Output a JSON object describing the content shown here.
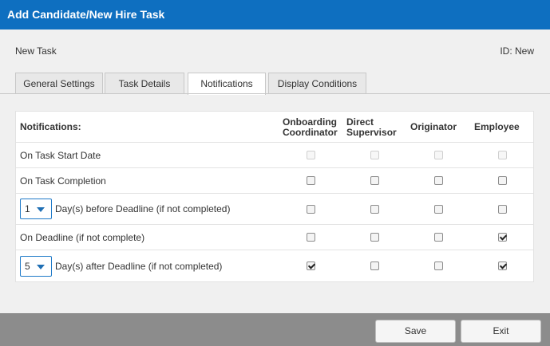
{
  "window": {
    "title": "Add Candidate/New Hire Task"
  },
  "task": {
    "name": "New Task",
    "id_label": "ID: New"
  },
  "tabs": [
    {
      "label": "General Settings",
      "active": false
    },
    {
      "label": "Task Details",
      "active": false
    },
    {
      "label": "Notifications",
      "active": true
    },
    {
      "label": "Display Conditions",
      "active": false
    }
  ],
  "table": {
    "header_label": "Notifications:",
    "columns": [
      {
        "line1": "Onboarding",
        "line2": "Coordinator"
      },
      {
        "line1": "Direct",
        "line2": "Supervisor"
      },
      {
        "line1": "Originator",
        "line2": ""
      },
      {
        "line1": "Employee",
        "line2": ""
      }
    ],
    "rows": [
      {
        "label": "On Task Start Date",
        "select_value": null,
        "checks": [
          false,
          false,
          false,
          false
        ],
        "disabled": true
      },
      {
        "label": "On Task Completion",
        "select_value": null,
        "checks": [
          false,
          false,
          false,
          false
        ],
        "disabled": false
      },
      {
        "label": "Day(s) before Deadline (if not completed)",
        "select_value": "1",
        "checks": [
          false,
          false,
          false,
          false
        ],
        "disabled": false
      },
      {
        "label": "On Deadline (if not complete)",
        "select_value": null,
        "checks": [
          false,
          false,
          false,
          true
        ],
        "disabled": false
      },
      {
        "label": "Day(s) after Deadline (if not completed)",
        "select_value": "5",
        "checks": [
          true,
          false,
          false,
          true
        ],
        "disabled": false
      }
    ]
  },
  "footer": {
    "save_label": "Save",
    "exit_label": "Exit"
  }
}
